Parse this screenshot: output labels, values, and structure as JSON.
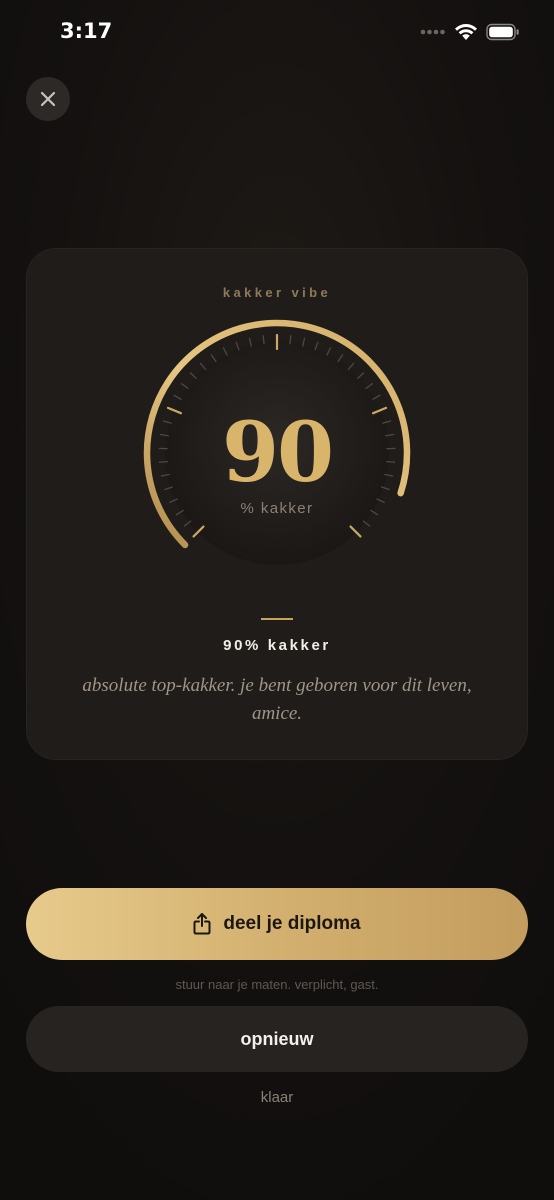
{
  "status_bar": {
    "time": "3:17",
    "icons": [
      "cellular-dots-icon",
      "wifi-icon",
      "battery-icon"
    ]
  },
  "header": {
    "close_icon": "close-icon"
  },
  "card": {
    "title": "kakker vibe",
    "gauge": {
      "value": "90",
      "unit": "% kakker",
      "percent": 90
    },
    "result_title": "90% kakker",
    "result_desc": "absolute top-kakker. je bent geboren voor dit leven, amice."
  },
  "actions": {
    "share_label": "deel je diploma",
    "share_icon": "share-icon",
    "share_hint": "stuur naar je maten. verplicht, gast.",
    "again_label": "opnieuw",
    "done_label": "klaar"
  },
  "colors": {
    "accent": "#d9b56c",
    "background": "#141110",
    "card": "#1f1c1a"
  }
}
